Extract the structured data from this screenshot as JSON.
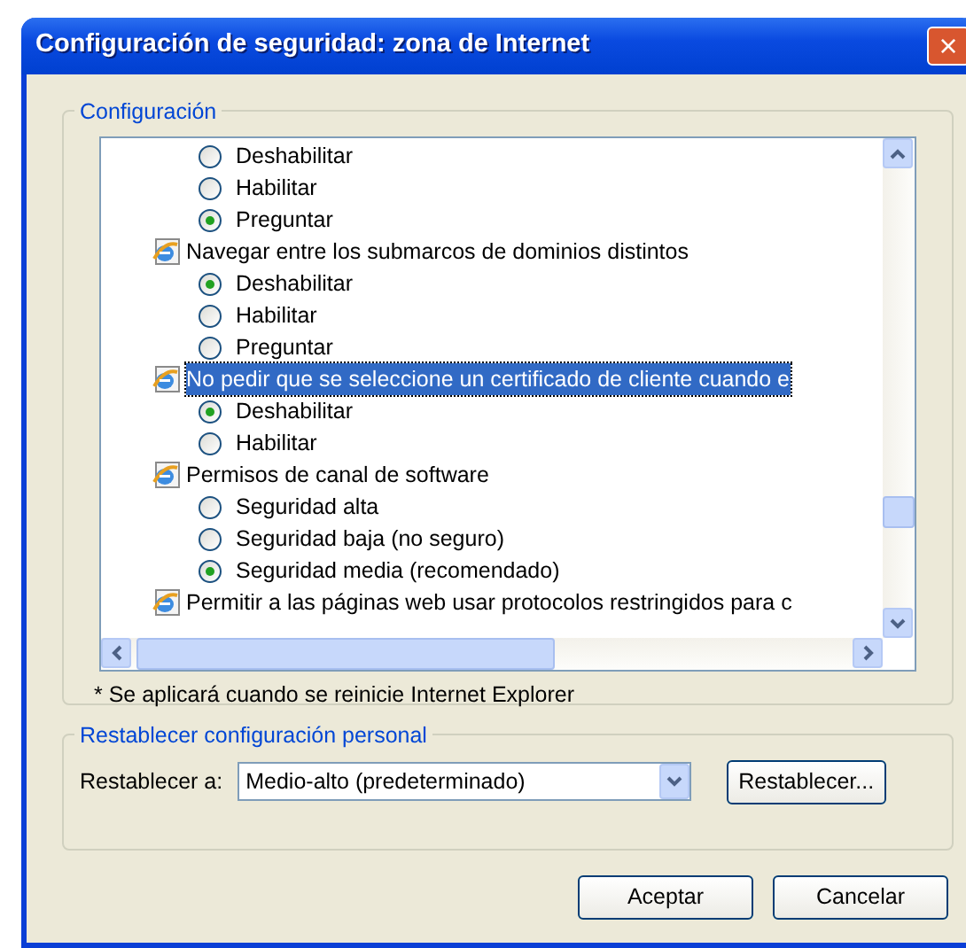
{
  "window": {
    "title": "Configuración de seguridad: zona de Internet",
    "close": "×"
  },
  "settings": {
    "legend": "Configuración",
    "groups": [
      {
        "options": [
          {
            "label": "Deshabilitar",
            "selected": false
          },
          {
            "label": "Habilitar",
            "selected": false
          },
          {
            "label": "Preguntar",
            "selected": true
          }
        ]
      },
      {
        "label": "Navegar entre los submarcos de dominios distintos",
        "selected": false,
        "options": [
          {
            "label": "Deshabilitar",
            "selected": true
          },
          {
            "label": "Habilitar",
            "selected": false
          },
          {
            "label": "Preguntar",
            "selected": false
          }
        ]
      },
      {
        "label": "No pedir que se seleccione un certificado de cliente cuando e",
        "selected": true,
        "options": [
          {
            "label": "Deshabilitar",
            "selected": true
          },
          {
            "label": "Habilitar",
            "selected": false
          }
        ]
      },
      {
        "label": "Permisos de canal de software",
        "selected": false,
        "options": [
          {
            "label": "Seguridad alta",
            "selected": false
          },
          {
            "label": "Seguridad baja (no seguro)",
            "selected": false
          },
          {
            "label": "Seguridad media (recomendado)",
            "selected": true
          }
        ]
      },
      {
        "label": "Permitir a las páginas web usar protocolos restringidos para c",
        "selected": false
      }
    ],
    "note": "* Se aplicará cuando se reinicie Internet Explorer"
  },
  "reset": {
    "legend": "Restablecer configuración personal",
    "label": "Restablecer a:",
    "value": "Medio-alto (predeterminado)",
    "button": "Restablecer..."
  },
  "buttons": [
    "Aceptar",
    "Cancelar"
  ]
}
